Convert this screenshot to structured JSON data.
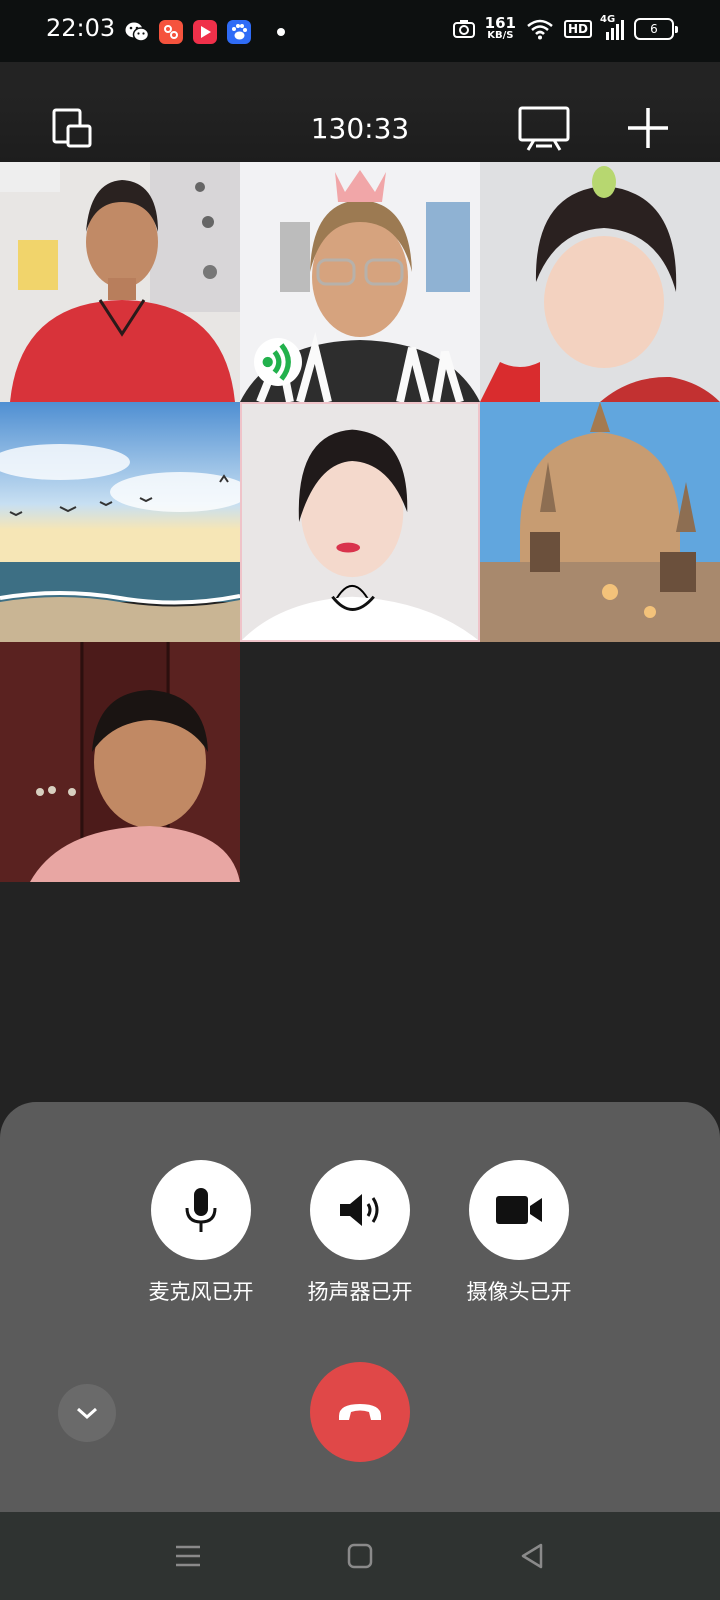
{
  "status_bar": {
    "time": "22:03",
    "net_speed_value": "161",
    "net_speed_unit": "KB/S",
    "hd_label": "HD",
    "network_type": "4G",
    "battery_level": "6",
    "notification_icons": [
      "wechat-icon",
      "app-icon-orange",
      "video-app-icon",
      "baidu-icon"
    ]
  },
  "top_bar": {
    "call_duration": "130:33",
    "icons": [
      "switch-window-icon",
      "screen-share-icon",
      "add-participant-icon"
    ]
  },
  "participants": [
    {
      "tile": "participant-1",
      "speaking": false
    },
    {
      "tile": "participant-2",
      "speaking": true
    },
    {
      "tile": "participant-3",
      "speaking": false
    },
    {
      "tile": "participant-4",
      "speaking": false
    },
    {
      "tile": "participant-5",
      "speaking": false
    },
    {
      "tile": "participant-6",
      "speaking": false
    },
    {
      "tile": "participant-7",
      "speaking": false
    }
  ],
  "controls": {
    "mic_label": "麦克风已开",
    "speaker_label": "扬声器已开",
    "camera_label": "摄像头已开"
  },
  "colors": {
    "hangup": "#e04848",
    "panel": "#5b5b5b",
    "background": "#232323",
    "speaking_indicator": "#22b14c"
  }
}
